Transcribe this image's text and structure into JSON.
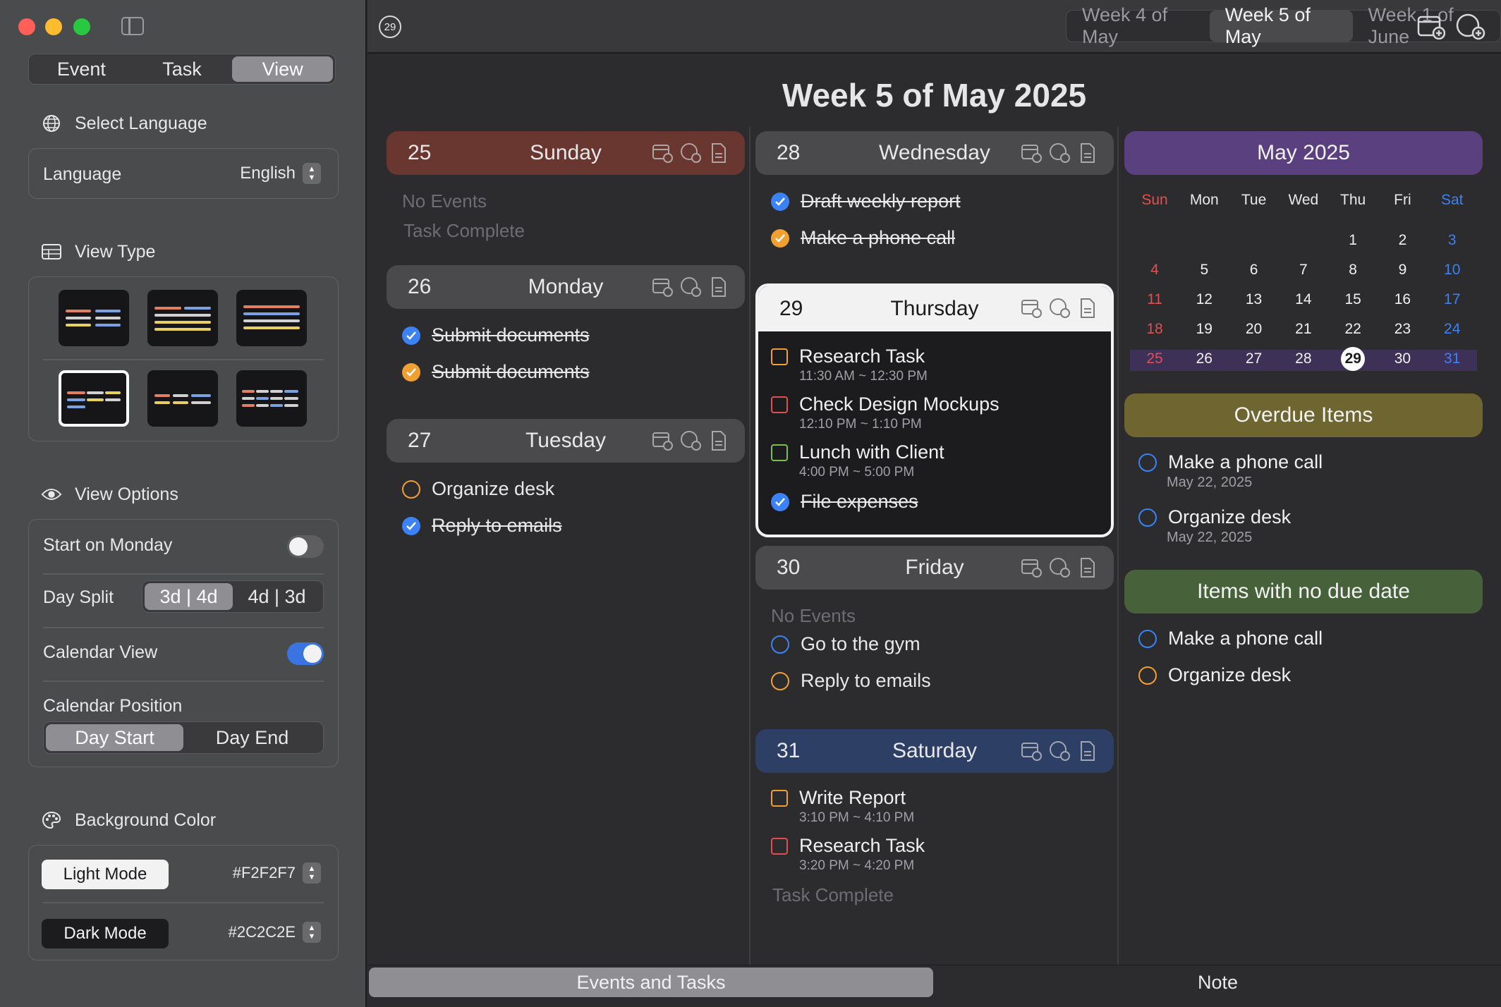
{
  "sidebar": {
    "mode_tabs": [
      "Event",
      "Task",
      "View"
    ],
    "language_section": "Select Language",
    "language_label": "Language",
    "language_value": "English",
    "view_type_section": "View Type",
    "view_options_section": "View Options",
    "start_on_monday": "Start on Monday",
    "day_split": "Day Split",
    "day_split_options": [
      "3d | 4d",
      "4d | 3d"
    ],
    "calendar_view": "Calendar View",
    "calendar_position": "Calendar Position",
    "calendar_position_options": [
      "Day Start",
      "Day End"
    ],
    "background_color_section": "Background Color",
    "light_mode": "Light Mode",
    "light_mode_value": "#F2F2F7",
    "dark_mode": "Dark Mode",
    "dark_mode_value": "#2C2C2E"
  },
  "topbar": {
    "today_badge": "29",
    "weeks": [
      "Week 4 of May",
      "Week 5 of May",
      "Week 1 of June"
    ]
  },
  "main": {
    "title": "Week 5 of May 2025",
    "days": [
      {
        "num": "25",
        "name": "Sunday",
        "empty_events": "No Events",
        "task_note": "Task Complete"
      },
      {
        "num": "26",
        "name": "Monday",
        "tasks": [
          "Submit documents",
          "Submit documents"
        ]
      },
      {
        "num": "27",
        "name": "Tuesday",
        "tasks": [
          "Organize desk",
          "Reply to emails"
        ]
      },
      {
        "num": "28",
        "name": "Wednesday",
        "tasks": [
          "Draft weekly report",
          "Make a phone call"
        ]
      },
      {
        "num": "29",
        "name": "Thursday",
        "events": [
          {
            "title": "Research Task",
            "time": "11:30 AM ~ 12:30 PM"
          },
          {
            "title": "Check Design Mockups",
            "time": "12:10 PM ~ 1:10 PM"
          },
          {
            "title": "Lunch with Client",
            "time": "4:00 PM ~ 5:00 PM"
          }
        ],
        "tasks": [
          "File expenses"
        ]
      },
      {
        "num": "30",
        "name": "Friday",
        "empty_events": "No Events",
        "tasks": [
          "Go to the gym",
          "Reply to emails"
        ]
      },
      {
        "num": "31",
        "name": "Saturday",
        "events": [
          {
            "title": "Write Report",
            "time": "3:10 PM ~ 4:10 PM"
          },
          {
            "title": "Research Task",
            "time": "3:20 PM ~ 4:20 PM"
          }
        ],
        "task_note": "Task Complete"
      }
    ]
  },
  "calendar": {
    "title": "May 2025",
    "weekdays": [
      "Sun",
      "Mon",
      "Tue",
      "Wed",
      "Thu",
      "Fri",
      "Sat"
    ],
    "weeks": [
      [
        "",
        "",
        "",
        "",
        "1",
        "2",
        "3"
      ],
      [
        "4",
        "5",
        "6",
        "7",
        "8",
        "9",
        "10"
      ],
      [
        "11",
        "12",
        "13",
        "14",
        "15",
        "16",
        "17"
      ],
      [
        "18",
        "19",
        "20",
        "21",
        "22",
        "23",
        "24"
      ],
      [
        "25",
        "26",
        "27",
        "28",
        "29",
        "30",
        "31"
      ]
    ],
    "today": "29"
  },
  "overdue": {
    "title": "Overdue Items",
    "items": [
      {
        "title": "Make a phone call",
        "date": "May 22, 2025"
      },
      {
        "title": "Organize desk",
        "date": "May 22, 2025"
      }
    ]
  },
  "no_due": {
    "title": "Items with no due date",
    "items": [
      "Make a phone call",
      "Organize desk"
    ]
  },
  "bottom_tabs": [
    "Events and Tasks",
    "Note"
  ],
  "colors": {
    "sunday_header": "#6a3630",
    "saturday_header": "#2e3f66",
    "calendar_header": "#5b4080",
    "overdue_header": "#6e6530",
    "no_due_header": "#47613a",
    "task_blue": "#3b82f6",
    "task_orange": "#f0a030"
  }
}
